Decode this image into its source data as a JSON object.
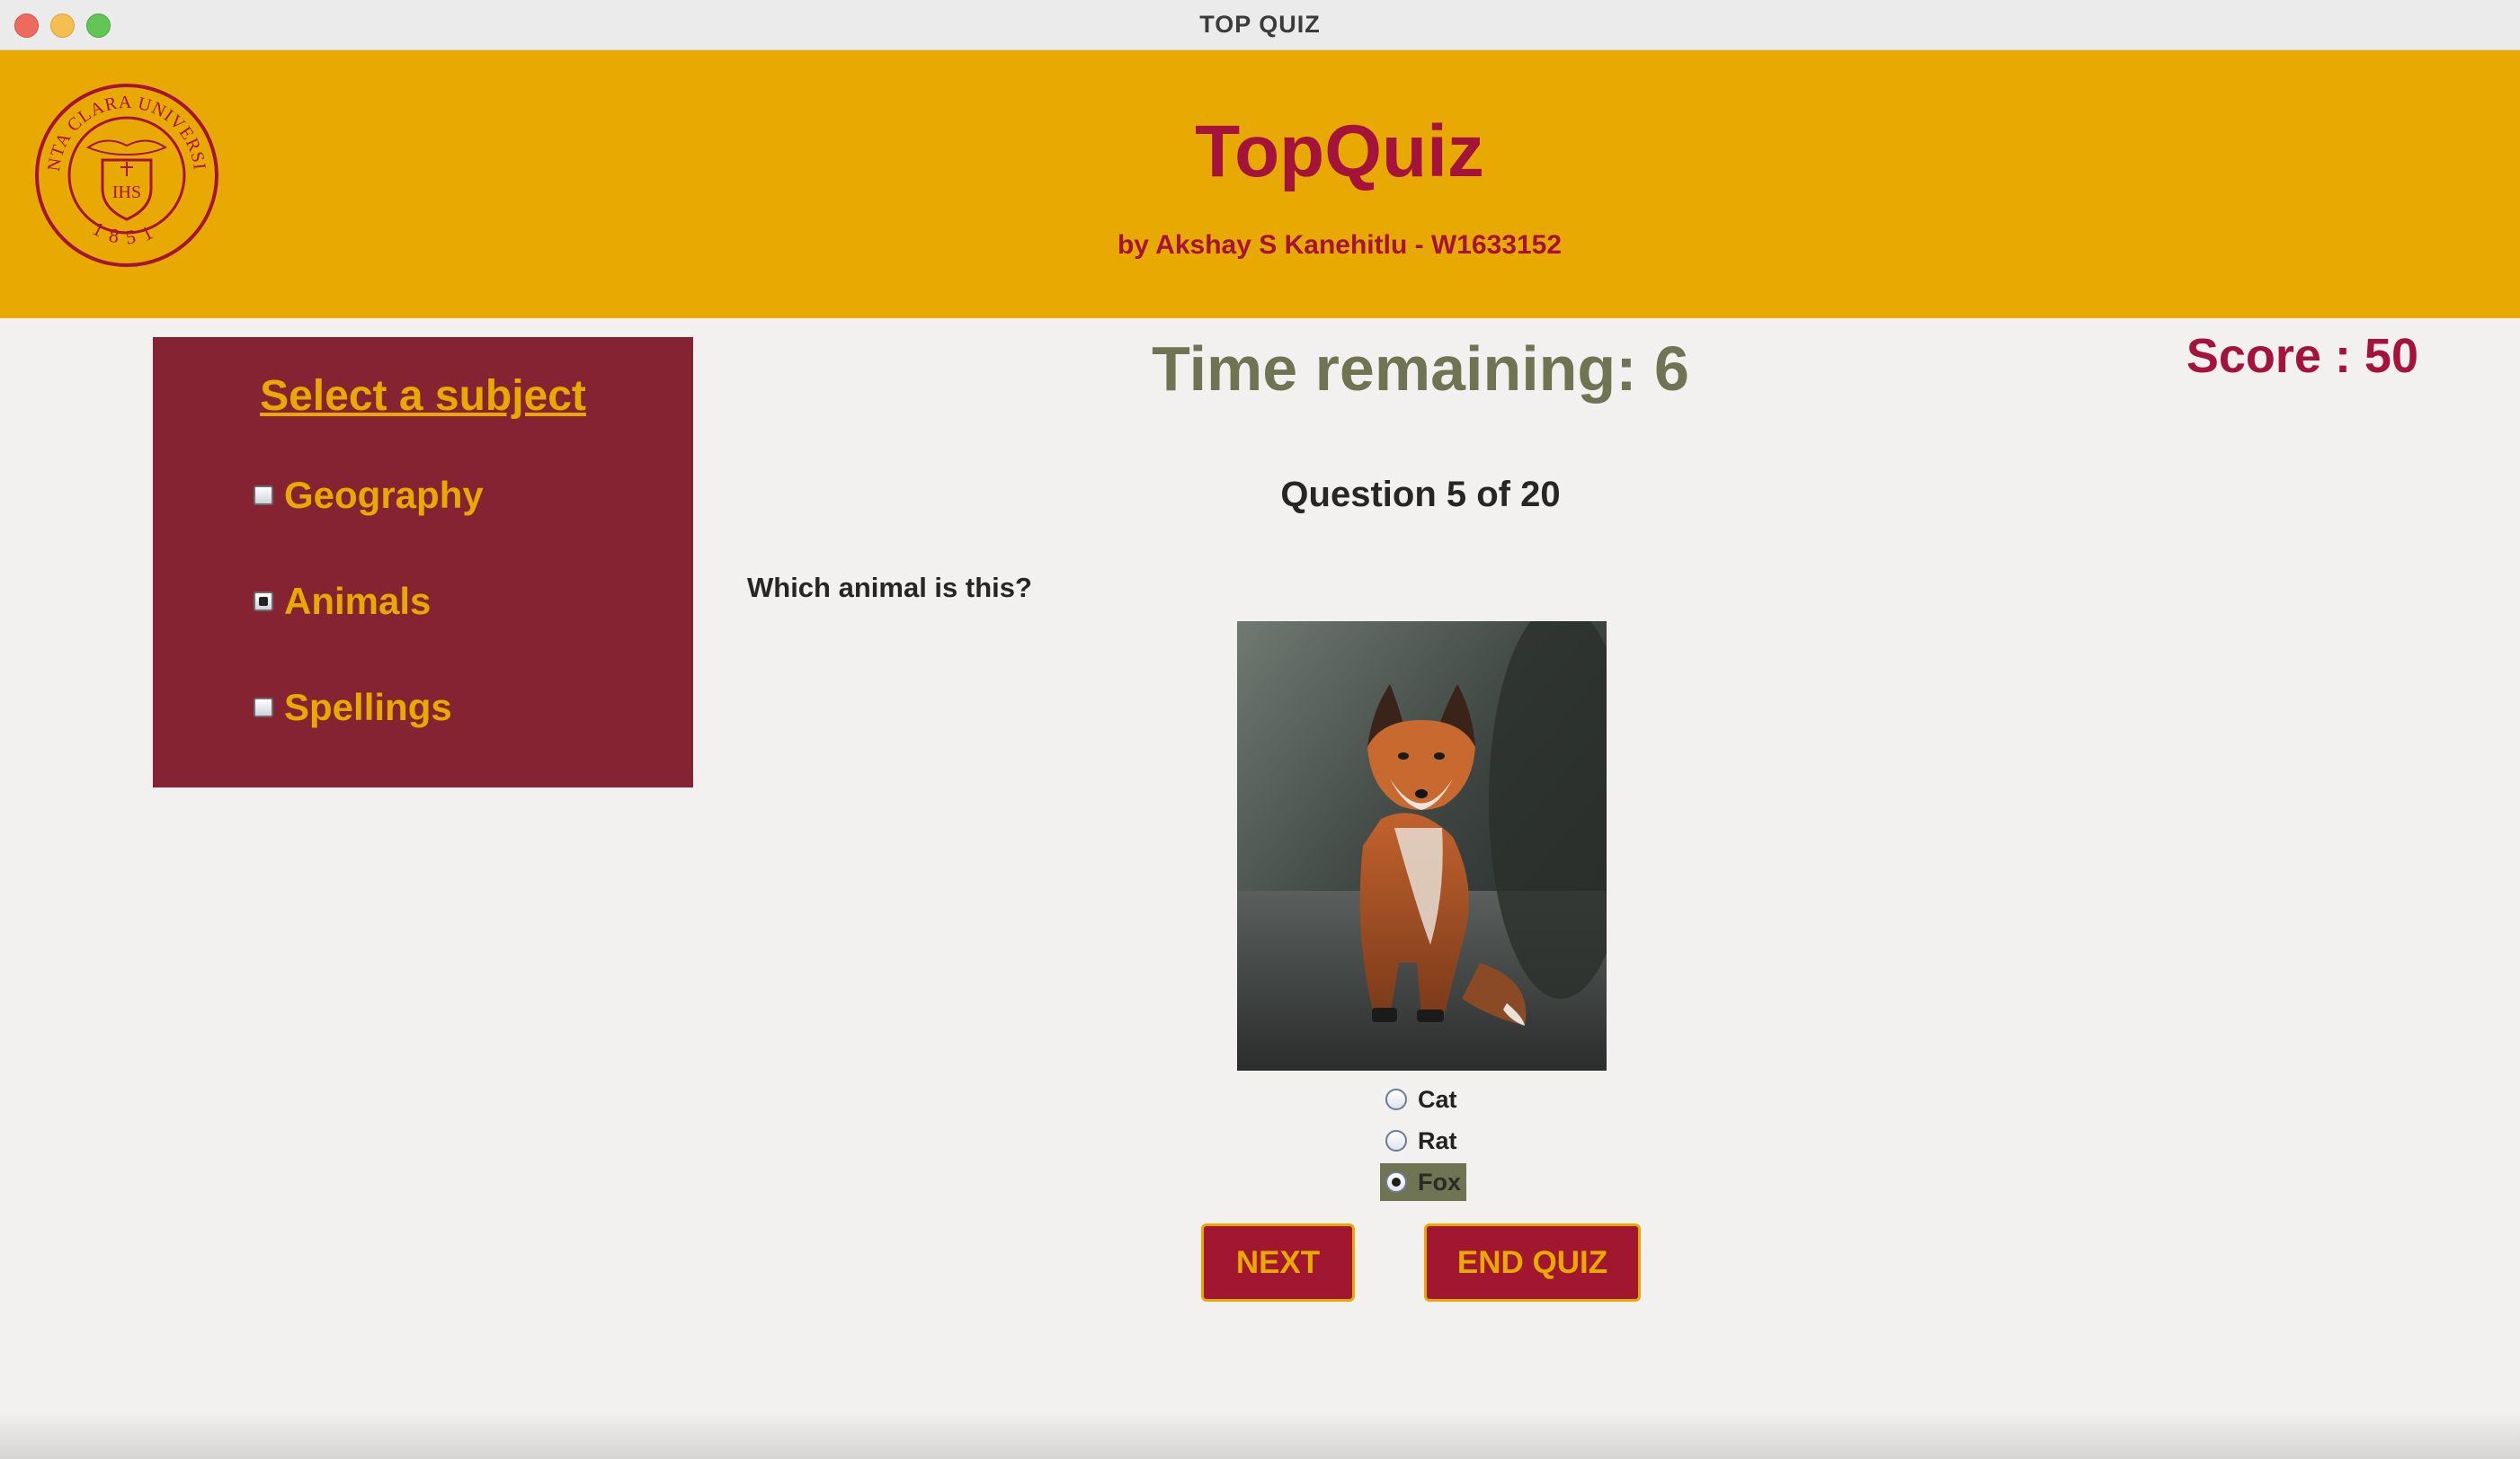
{
  "window": {
    "title": "TOP QUIZ"
  },
  "header": {
    "app_title": "TopQuiz",
    "byline": "by Akshay S Kanehitlu - W1633152",
    "seal": {
      "text": "SANTA CLARA UNIVERSITY",
      "year": "1851",
      "monogram": "IHS"
    }
  },
  "sidebar": {
    "heading": "Select a subject",
    "subjects": [
      {
        "label": "Geography",
        "checked": false
      },
      {
        "label": "Animals",
        "checked": true
      },
      {
        "label": "Spellings",
        "checked": false
      }
    ]
  },
  "quiz": {
    "time_remaining": "Time remaining: 6",
    "score": "Score : 50",
    "question_number": "Question 5 of 20",
    "question": "Which animal is this?",
    "image": "fox photograph",
    "options": [
      {
        "label": "Cat",
        "selected": false
      },
      {
        "label": "Rat",
        "selected": false
      },
      {
        "label": "Fox",
        "selected": true
      }
    ]
  },
  "buttons": {
    "next": "NEXT",
    "end_quiz": "END QUIZ"
  },
  "colors": {
    "header_bg": "#e8a902",
    "brand_red": "#a4133c",
    "sidebar_bg": "#862333",
    "timer_green": "#6f7552",
    "button_bg": "#a0172f"
  }
}
